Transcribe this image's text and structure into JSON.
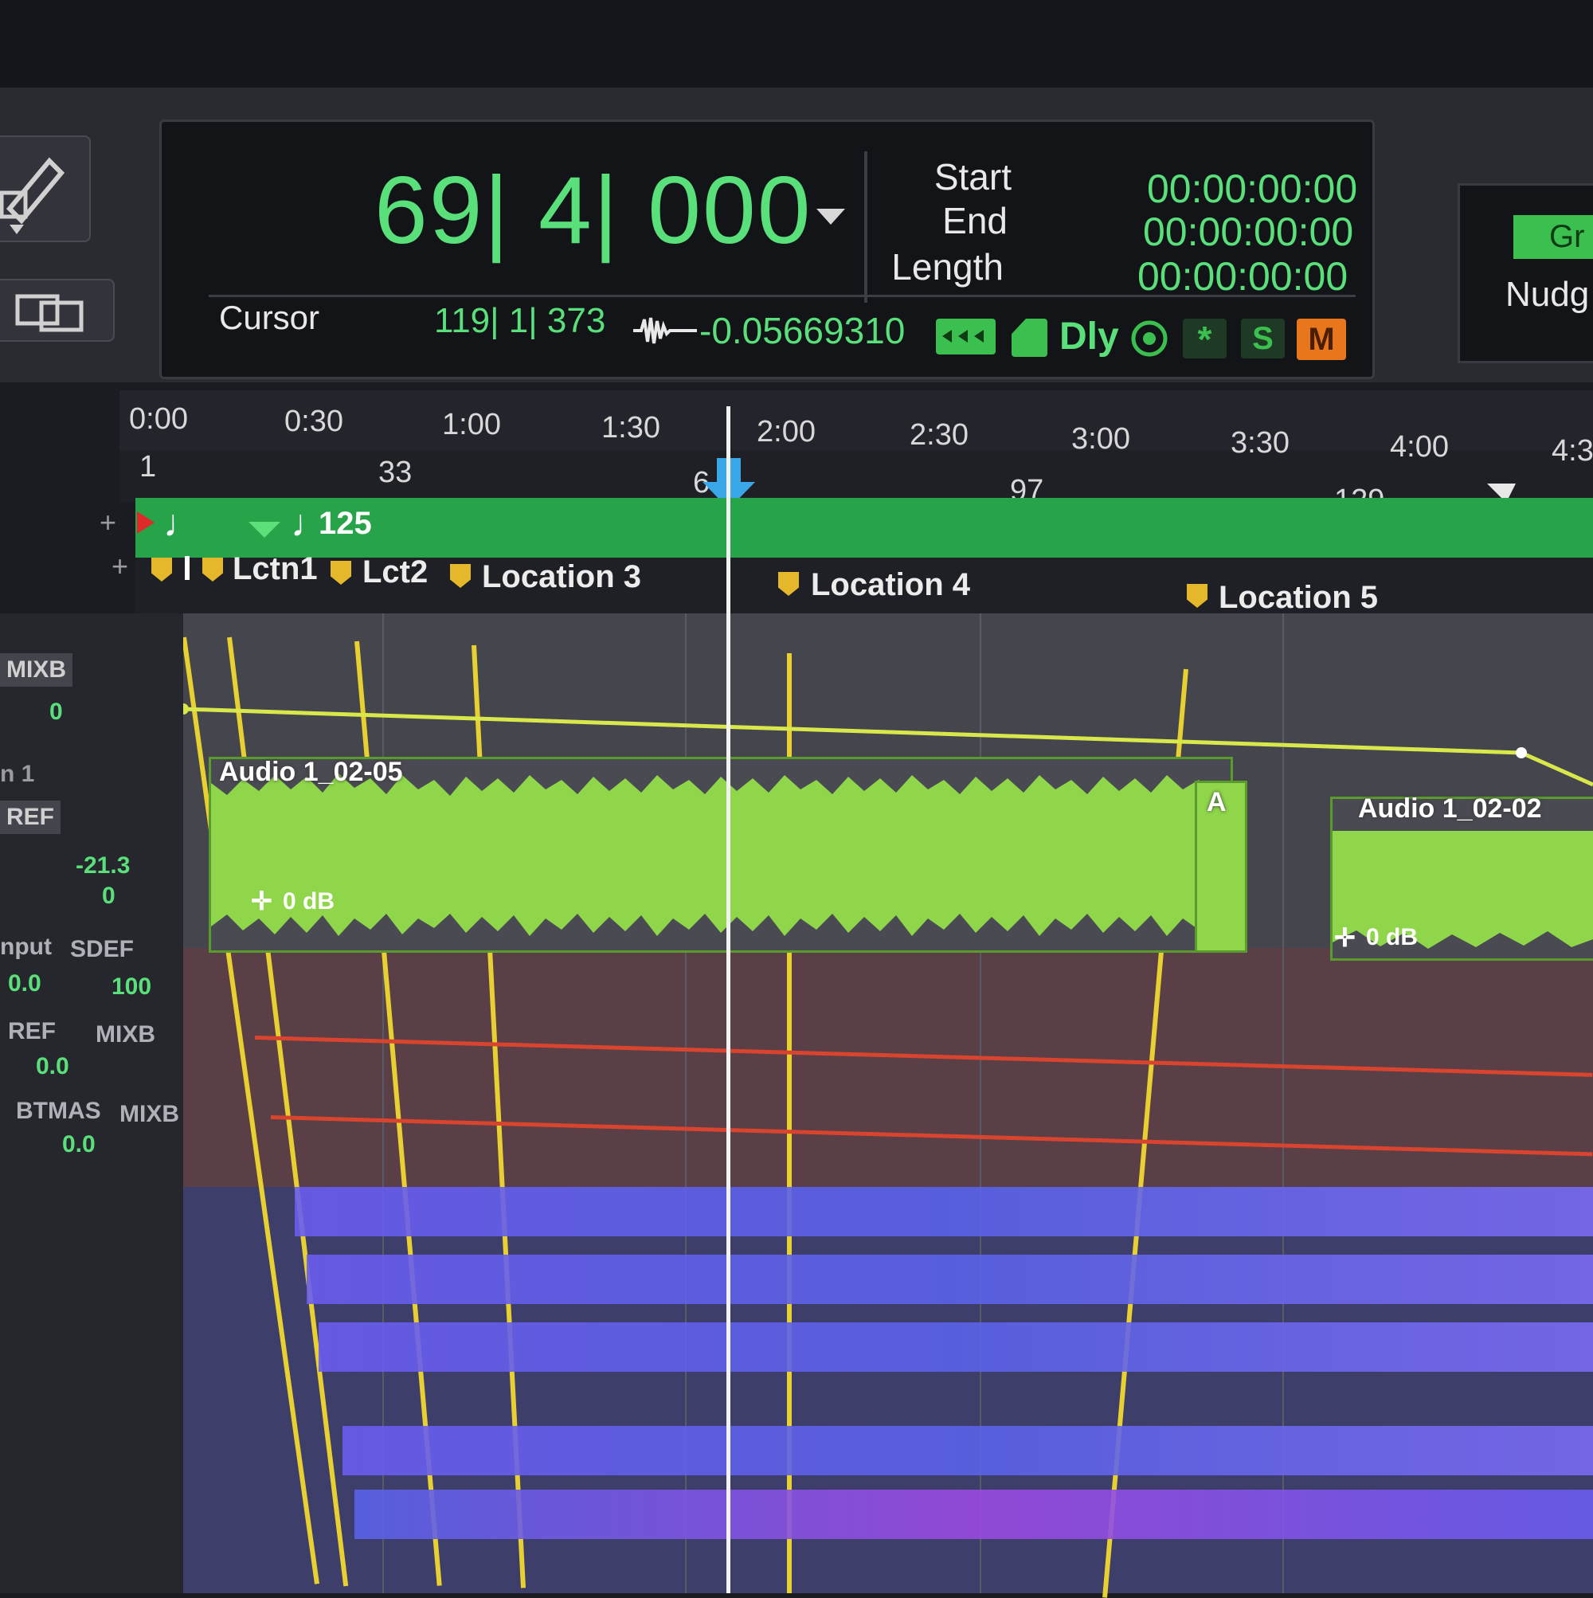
{
  "counter": {
    "main": "69| 4| 000",
    "selection": {
      "start_label": "Start",
      "end_label": "End",
      "length_label": "Length",
      "start_value": "00:00:00:00",
      "end_value": "00:00:00:00",
      "length_value": "00:00:00:00"
    },
    "cursor_label": "Cursor",
    "cursor_value": "119| 1| 373",
    "sample_value": "-0.05669310",
    "dly_label": "Dly",
    "s_label": "S",
    "m_label": "M"
  },
  "grid": {
    "grid_label": "Gr",
    "nudge_label": "Nudg"
  },
  "ruler": {
    "minsecs": [
      "0:00",
      "0:30",
      "1:00",
      "1:30",
      "2:00",
      "2:30",
      "3:00",
      "3:30",
      "4:00",
      "4:3"
    ],
    "bars": [
      "1",
      "33",
      "6",
      "97",
      "129"
    ]
  },
  "tempo": {
    "value": "125"
  },
  "markers": {
    "items": [
      "Lctn1",
      "Lct2",
      "Location 3",
      "Location 4",
      "Location 5"
    ]
  },
  "sidebar": {
    "mixb": "MIXB",
    "pan1": "0",
    "track_name": "n 1",
    "ref": "REF",
    "level": "-21.3",
    "pan2": "0",
    "input": "nput",
    "sdef": "SDEF",
    "vol_a": "0.0",
    "pan_a": "100",
    "ref2": "REF",
    "mixb2": "MIXB",
    "vol_b": "0.0",
    "btmas": "BTMAS",
    "mixb3": "MIXB",
    "vol_c": "0.0"
  },
  "clips": {
    "audio_main": "Audio 1_02-05",
    "audio_main_gain": "0 dB",
    "audio_small": "A",
    "audio_right": "Audio 1_02-02",
    "audio_right_gain": "0 dB"
  },
  "colors": {
    "counter_green": "#59e07a",
    "clip_green": "#8fd64a",
    "tempo_green": "#27a34a",
    "marker_yellow": "#e5b72b",
    "auto_red": "#d9442f",
    "mute_orange": "#e8761c"
  }
}
